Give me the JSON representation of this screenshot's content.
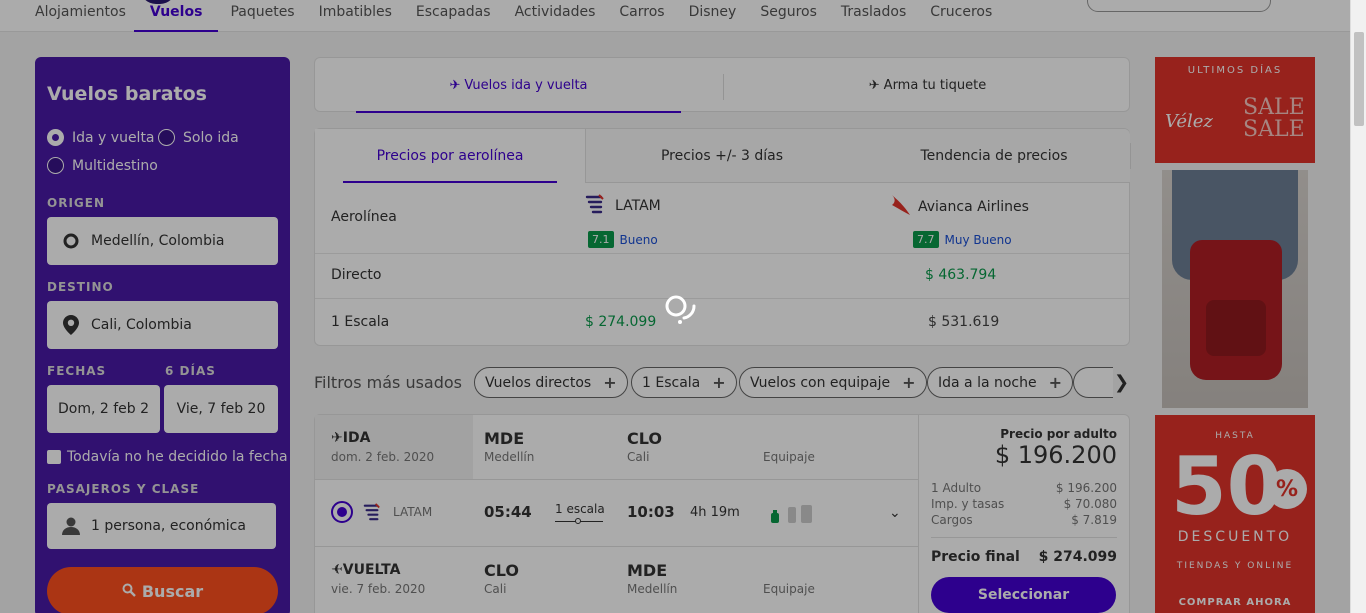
{
  "nav": {
    "items": [
      "Alojamientos",
      "Vuelos",
      "Paquetes",
      "Imbatibles",
      "Escapadas",
      "Actividades",
      "Carros",
      "Disney",
      "Seguros",
      "Traslados",
      "Cruceros"
    ],
    "active": "Vuelos"
  },
  "search": {
    "title": "Vuelos baratos",
    "trip_types": [
      "Ida y vuelta",
      "Solo ida",
      "Multidestino"
    ],
    "trip_selected": "Ida y vuelta",
    "origin_label": "ORIGEN",
    "origin_value": "Medellín, Colombia",
    "destination_label": "DESTINO",
    "destination_value": "Cali, Colombia",
    "dates_label": "FECHAS",
    "days_label": "6 DÍAS",
    "date_out": "Dom, 2 feb 2",
    "date_back": "Vie, 7 feb 20",
    "undecided": "Todavía no he decidido la fecha",
    "passengers_label": "PASAJEROS Y CLASE",
    "passengers_value": "1 persona, económica",
    "search_button": "Buscar"
  },
  "mode_tabs": [
    "Vuelos ida y vuelta",
    "Arma tu tiquete"
  ],
  "matrix": {
    "tabs": [
      "Precios por aerolínea",
      "Precios +/- 3 días",
      "Tendencia de precios"
    ],
    "row_labels": [
      "Aerolínea",
      "Directo",
      "1 Escala"
    ],
    "airlines": [
      {
        "name": "LATAM",
        "score": "7.1",
        "score_word": "Bueno",
        "direct": "",
        "one_stop": "$ 274.099"
      },
      {
        "name": "Avianca Airlines",
        "score": "7.7",
        "score_word": "Muy Bueno",
        "direct": "$ 463.794",
        "one_stop": "$ 531.619"
      }
    ]
  },
  "filters": {
    "title": "Filtros más usados",
    "chips": [
      "Vuelos directos",
      "1 Escala",
      "Vuelos con equipaje",
      "Ida a la noche"
    ]
  },
  "flight": {
    "outbound": {
      "label": "IDA",
      "date": "dom. 2 feb. 2020",
      "from_code": "MDE",
      "from_city": "Medellín",
      "to_code": "CLO",
      "to_city": "Cali",
      "equip_label": "Equipaje",
      "airline": "LATAM",
      "depart": "05:44",
      "stops": "1 escala",
      "arrive": "10:03",
      "duration": "4h 19m"
    },
    "return": {
      "label": "VUELTA",
      "date": "vie. 7 feb. 2020",
      "from_code": "CLO",
      "from_city": "Cali",
      "to_code": "MDE",
      "to_city": "Medellín",
      "equip_label": "Equipaje"
    },
    "price": {
      "per_adult_label": "Precio por adulto",
      "per_adult": "$ 196.200",
      "rows": [
        {
          "label": "1 Adulto",
          "value": "$ 196.200"
        },
        {
          "label": "Imp. y tasas",
          "value": "$ 70.080"
        },
        {
          "label": "Cargos",
          "value": "$ 7.819"
        }
      ],
      "final_label": "Precio final",
      "final_value": "$ 274.099",
      "select_button": "Seleccionar"
    }
  },
  "ads": {
    "ad1_top": "ULTIMOS DÍAS",
    "ad1_brand": "Vélez",
    "ad1_sale": "SALE",
    "ad3_hasta": "HASTA",
    "ad3_number": "50",
    "ad3_pct": "%",
    "ad3_desc": "DESCUENTO",
    "ad3_tiendas": "TIENDAS Y ONLINE",
    "ad3_cta": "COMPRAR AHORA"
  },
  "colors": {
    "brand": "#4300d2",
    "sidebar": "#4a1aa8",
    "cta": "#ff4f1e",
    "price_green": "#0a9a4b",
    "ad_red": "#e2342b"
  }
}
